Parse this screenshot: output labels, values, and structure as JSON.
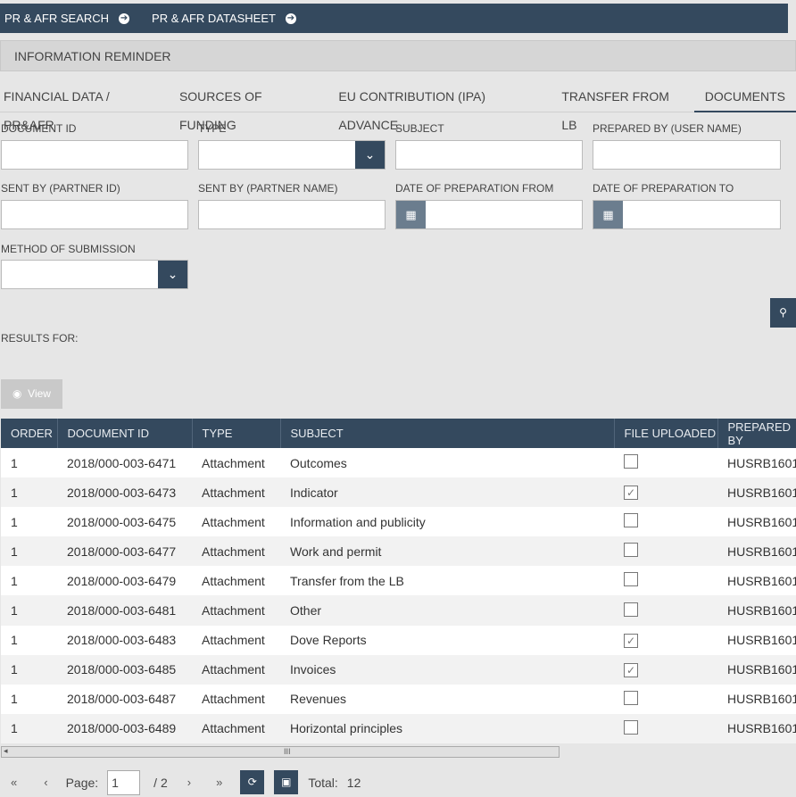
{
  "topnav": [
    {
      "label": "PR & AFR SEARCH",
      "icon": "arrow-right-circle-icon"
    },
    {
      "label": "PR & AFR DATASHEET",
      "icon": "arrow-right-circle-icon"
    }
  ],
  "reminder": "INFORMATION REMINDER",
  "tabs": [
    "FINANCIAL DATA / PR&AFR",
    "SOURCES OF FUNDING",
    "EU CONTRIBUTION (IPA) ADVANCE",
    "TRANSFER FROM LB",
    "DOCUMENTS"
  ],
  "active_tab": "DOCUMENTS",
  "filters": {
    "document_id": {
      "label": "DOCUMENT ID",
      "value": ""
    },
    "type": {
      "label": "TYPE",
      "value": ""
    },
    "subject": {
      "label": "SUBJECT",
      "value": ""
    },
    "prepared_by": {
      "label": "PREPARED BY (USER NAME)",
      "value": ""
    },
    "sent_by_id": {
      "label": "SENT BY (PARTNER ID)",
      "value": ""
    },
    "sent_by_name": {
      "label": "SENT BY (PARTNER NAME)",
      "value": ""
    },
    "date_from": {
      "label": "DATE OF PREPARATION FROM",
      "value": ""
    },
    "date_to": {
      "label": "DATE OF PREPARATION TO",
      "value": ""
    },
    "method": {
      "label": "METHOD OF SUBMISSION",
      "value": ""
    }
  },
  "results_label": "RESULTS FOR:",
  "view_label": "View",
  "table": {
    "columns": [
      "ORDER",
      "DOCUMENT ID",
      "TYPE",
      "SUBJECT",
      "FILE UPLOADED",
      "PREPARED BY"
    ],
    "rows": [
      {
        "order": "1",
        "doc_id": "2018/000-003-6471",
        "type": "Attachment",
        "subject": "Outcomes",
        "uploaded": false,
        "prepared_by": "HUSRB1601"
      },
      {
        "order": "1",
        "doc_id": "2018/000-003-6473",
        "type": "Attachment",
        "subject": "Indicator",
        "uploaded": true,
        "prepared_by": "HUSRB1601"
      },
      {
        "order": "1",
        "doc_id": "2018/000-003-6475",
        "type": "Attachment",
        "subject": "Information and publicity",
        "uploaded": false,
        "prepared_by": "HUSRB1601"
      },
      {
        "order": "1",
        "doc_id": "2018/000-003-6477",
        "type": "Attachment",
        "subject": "Work and permit",
        "uploaded": false,
        "prepared_by": "HUSRB1601"
      },
      {
        "order": "1",
        "doc_id": "2018/000-003-6479",
        "type": "Attachment",
        "subject": "Transfer from the LB",
        "uploaded": false,
        "prepared_by": "HUSRB1601"
      },
      {
        "order": "1",
        "doc_id": "2018/000-003-6481",
        "type": "Attachment",
        "subject": "Other",
        "uploaded": false,
        "prepared_by": "HUSRB1601"
      },
      {
        "order": "1",
        "doc_id": "2018/000-003-6483",
        "type": "Attachment",
        "subject": "Dove Reports",
        "uploaded": true,
        "prepared_by": "HUSRB1601"
      },
      {
        "order": "1",
        "doc_id": "2018/000-003-6485",
        "type": "Attachment",
        "subject": "Invoices",
        "uploaded": true,
        "prepared_by": "HUSRB1601"
      },
      {
        "order": "1",
        "doc_id": "2018/000-003-6487",
        "type": "Attachment",
        "subject": "Revenues",
        "uploaded": false,
        "prepared_by": "HUSRB1601"
      },
      {
        "order": "1",
        "doc_id": "2018/000-003-6489",
        "type": "Attachment",
        "subject": "Horizontal principles",
        "uploaded": false,
        "prepared_by": "HUSRB1601"
      }
    ]
  },
  "pager": {
    "first": "«",
    "prev": "‹",
    "page_label": "Page:",
    "page": "1",
    "of": "/ 2",
    "next": "›",
    "last": "»",
    "total_label": "Total:",
    "total": "12"
  },
  "colors": {
    "navy": "#34495e",
    "background": "#e6e6e6"
  }
}
